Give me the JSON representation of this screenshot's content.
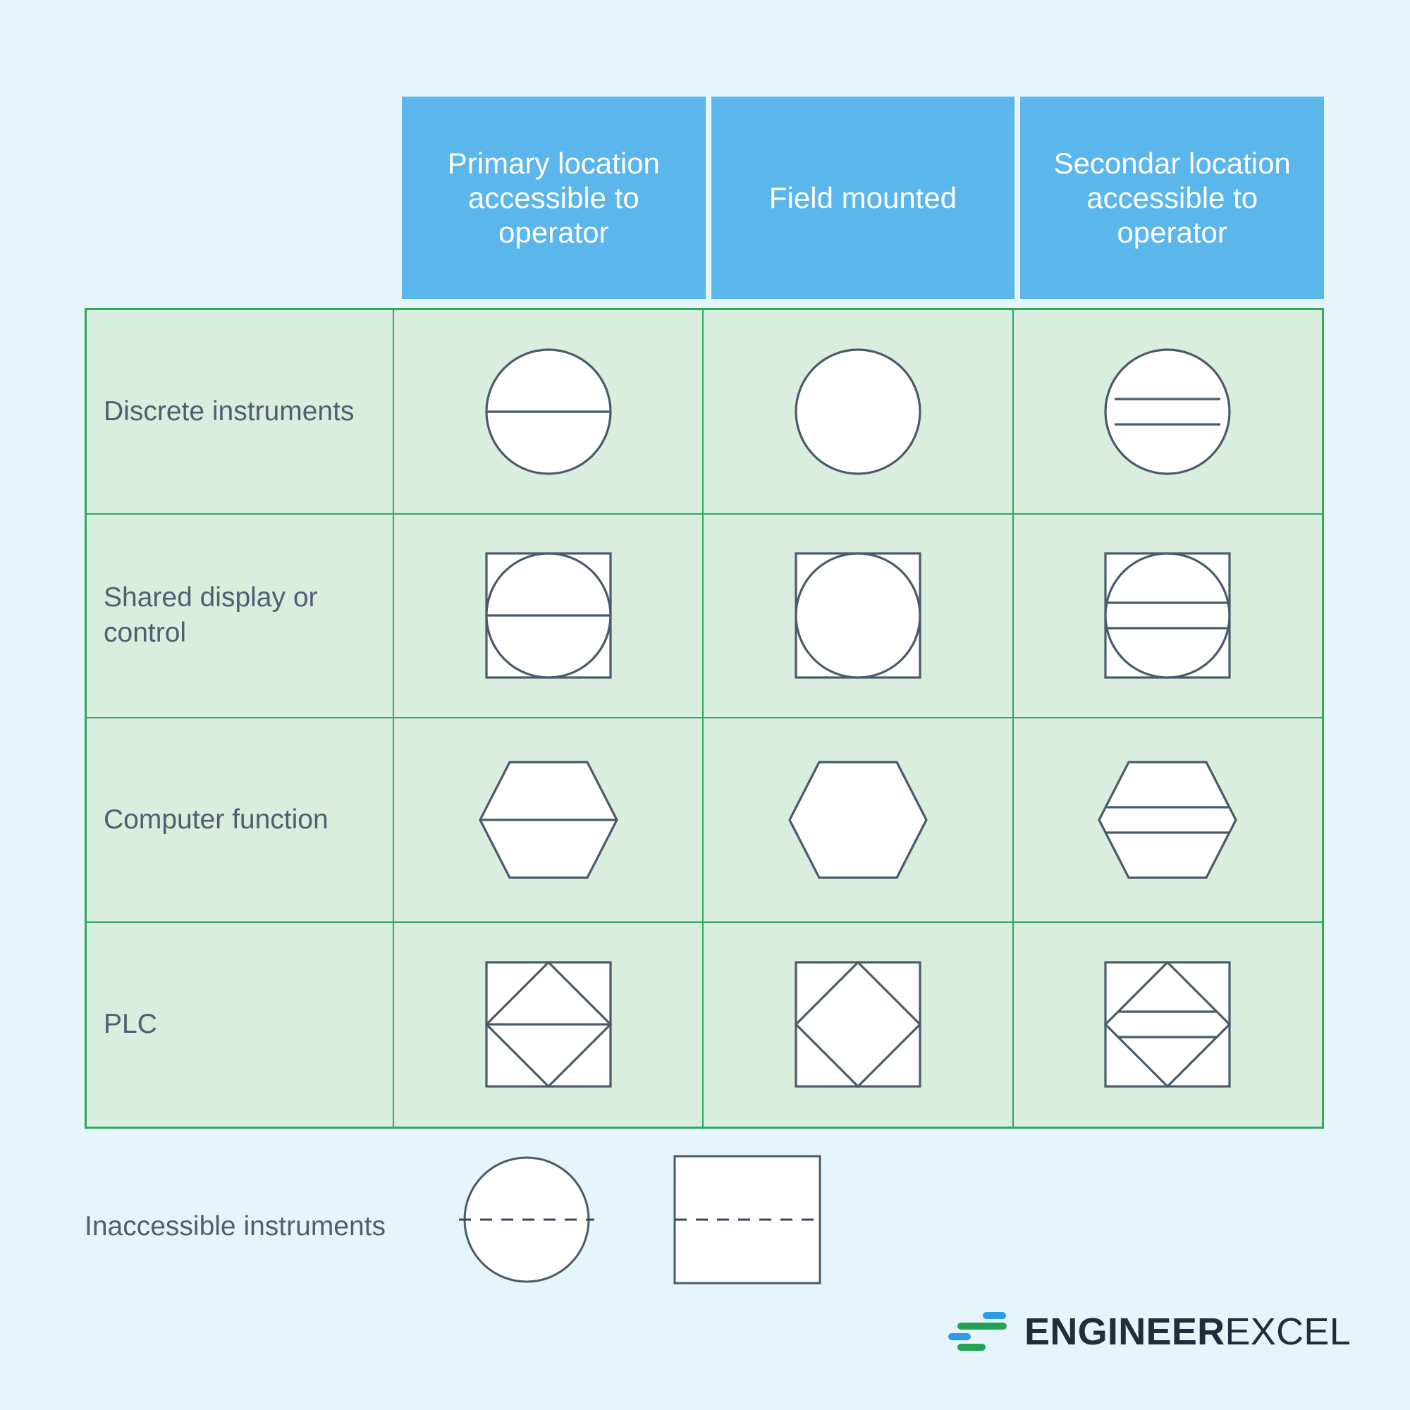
{
  "table": {
    "column_headers": [
      "Primary location accessible to operator",
      "Field mounted",
      "Secondar location accessible to operator"
    ],
    "row_labels": [
      "Discrete instruments",
      "Shared display or control",
      "Computer function",
      "PLC"
    ],
    "symbols": [
      [
        "circle-single-line",
        "circle-plain",
        "circle-double-line"
      ],
      [
        "square-circle-single-line",
        "square-circle-plain",
        "square-circle-double-line"
      ],
      [
        "hexagon-single-line",
        "hexagon-plain",
        "hexagon-double-line"
      ],
      [
        "square-diamond-single-line",
        "square-diamond-plain",
        "square-diamond-double-line"
      ]
    ]
  },
  "legend": {
    "label": "Inaccessible instruments",
    "shapes": [
      "circle-dashed-line",
      "square-dashed-line"
    ]
  },
  "logo": {
    "name_bold": "ENGINEER",
    "name_light": "EXCEL"
  },
  "colors": {
    "page_background": "#e6f4fc",
    "header_blue": "#5bb6ec",
    "cell_green_fill": "#d9eede",
    "cell_green_border": "#2eaa5c",
    "symbol_stroke": "#4a5a6b",
    "text_dark": "#505f70",
    "logo_dark": "#1f2d3d",
    "logo_blue": "#2e9bea",
    "logo_green": "#23a455"
  }
}
